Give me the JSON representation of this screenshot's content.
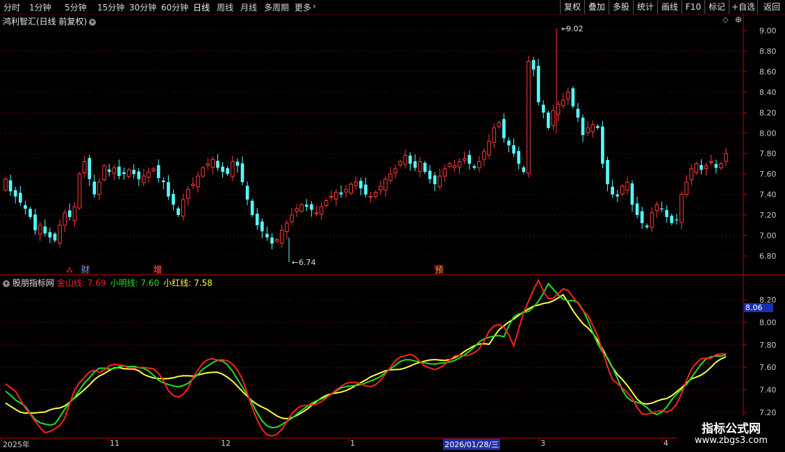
{
  "toolbar": {
    "periods": [
      "分时",
      "1分钟",
      "5分钟",
      "15分钟",
      "30分钟",
      "60分钟",
      "日线",
      "周线",
      "月线",
      "多周期",
      "更多"
    ],
    "active_period": "日线",
    "right_buttons": [
      "复权",
      "叠加",
      "多股",
      "统计",
      "画线",
      "F10",
      "标记",
      "+自选",
      "返回"
    ]
  },
  "main_pane": {
    "title": "鸿利智汇(日线 前复权)",
    "price_labels": [
      "9.00",
      "8.80",
      "8.60",
      "8.40",
      "8.20",
      "8.00",
      "7.80",
      "7.60",
      "7.40",
      "7.20",
      "7.00",
      "6.80"
    ],
    "high_marker": "9.02",
    "low_marker": "6.74",
    "event_tags": [
      "财",
      "增",
      "预"
    ],
    "colors": {
      "up": "#ff3a3a",
      "down": "#54ffff",
      "grid": "#a00000"
    }
  },
  "indicator_pane": {
    "name": "股朋指标网",
    "lines": [
      {
        "label": "金山线",
        "value": "7.69",
        "color": "#ff2020"
      },
      {
        "label": "小明线",
        "value": "7.60",
        "color": "#20e020"
      },
      {
        "label": "小红线",
        "value": "7.58",
        "color": "#ffff40"
      }
    ],
    "price_labels": [
      "8.20",
      "8.00",
      "7.80",
      "7.60",
      "7.40",
      "7.20"
    ],
    "current_tag": "8.06"
  },
  "date_axis": {
    "labels": [
      "2025年",
      "11",
      "12",
      "1",
      "3",
      "4"
    ],
    "cursor_date": "2026/01/28/三"
  },
  "watermark": {
    "line1": "指标公式网",
    "line2": "www.zbgs3.com"
  }
}
